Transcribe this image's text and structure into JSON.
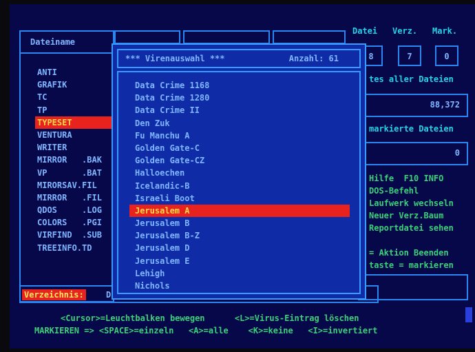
{
  "file_panel": {
    "header": "Dateiname",
    "files": [
      {
        "name": "ANTI",
        "selected": false
      },
      {
        "name": "GRAFIK",
        "selected": false
      },
      {
        "name": "TC",
        "selected": false
      },
      {
        "name": "TP",
        "selected": false
      },
      {
        "name": "TYPESET",
        "selected": true
      },
      {
        "name": "VENTURA",
        "selected": false
      },
      {
        "name": "WRITER",
        "selected": false
      },
      {
        "name": "MIRROR   .BAK",
        "selected": false
      },
      {
        "name": "VP       .BAT",
        "selected": false
      },
      {
        "name": "MIRORSAV.FIL",
        "selected": false
      },
      {
        "name": "MIRROR   .FIL",
        "selected": false
      },
      {
        "name": "QDOS     .LOG",
        "selected": false
      },
      {
        "name": "COLORS   .PGI",
        "selected": false
      },
      {
        "name": "VIRFIND  .SUB",
        "selected": false
      },
      {
        "name": "TREEINFO.TD",
        "selected": false
      }
    ]
  },
  "dir_bar": {
    "label": "Verzeichnis:",
    "value": "D:"
  },
  "menu": {
    "datei": "Datei",
    "verz": "Verz.",
    "mark": "Mark."
  },
  "counts": {
    "datei": "8",
    "verz": "7",
    "mark": "0"
  },
  "right_panel": {
    "total_label": "tes aller Dateien",
    "total_value": "88,372",
    "marked_label": "markierte Dateien",
    "marked_value": "0",
    "help_lines": [
      "Hilfe  F10 INFO",
      "DOS-Befehl",
      "Laufwerk wechseln",
      "Neuer Verz.Baum",
      "Reportdatei sehen"
    ],
    "action_lines": [
      "= Aktion Beenden",
      "taste = markieren"
    ]
  },
  "popup": {
    "title": "*** Virenauswahl ***",
    "count_label": "Anzahl: 61",
    "items": [
      {
        "name": "Data Crime 1168",
        "selected": false
      },
      {
        "name": "Data Crime 1280",
        "selected": false
      },
      {
        "name": "Data Crime II",
        "selected": false
      },
      {
        "name": "Den Zuk",
        "selected": false
      },
      {
        "name": "Fu Manchu A",
        "selected": false
      },
      {
        "name": "Golden Gate-C",
        "selected": false
      },
      {
        "name": "Golden Gate-CZ",
        "selected": false
      },
      {
        "name": "Halloechen",
        "selected": false
      },
      {
        "name": "Icelandic-B",
        "selected": false
      },
      {
        "name": "Israeli Boot",
        "selected": false
      },
      {
        "name": "Jerusalem A",
        "selected": true
      },
      {
        "name": "Jerusalem B",
        "selected": false
      },
      {
        "name": "Jerusalem B-Z",
        "selected": false
      },
      {
        "name": "Jerusalem D",
        "selected": false
      },
      {
        "name": "Jerusalem E",
        "selected": false
      },
      {
        "name": "Lehigh",
        "selected": false
      },
      {
        "name": "Nichols",
        "selected": false
      }
    ]
  },
  "footer": {
    "line1": "<Cursor>=Leuchtbalken bewegen      <L>=Virus-Eintrag löschen",
    "line2": "MARKIEREN => <SPACE>=einzeln   <A>=alle    <K>=keine   <I>=invertiert"
  },
  "colors": {
    "screen_bg": "#07084a",
    "popup_bg": "#0f2ca6",
    "frame": "#2a86f0",
    "highlight": "#e8231f",
    "highlight_text": "#ffd84a",
    "text": "#7fb6ff",
    "accent_cyan": "#26d2e6",
    "help_green": "#3bd07a"
  }
}
